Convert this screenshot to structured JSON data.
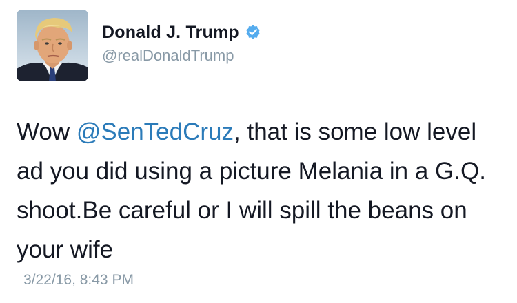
{
  "tweet": {
    "author": {
      "display_name": "Donald J. Trump",
      "handle": "@realDonaldTrump",
      "verified": true,
      "avatar_icon": "profile-photo"
    },
    "text": {
      "prefix": "Wow ",
      "mention": "@SenTedCruz",
      "suffix": ", that is some low level ad you did using a picture Melania in a G.Q. shoot.Be careful or I will spill the beans on your wife"
    },
    "timestamp": "3/22/16, 8:43 PM"
  },
  "colors": {
    "text": "#141823",
    "secondary_text": "#8899a6",
    "link": "#2b7bb9",
    "verified_badge": "#55acee"
  }
}
